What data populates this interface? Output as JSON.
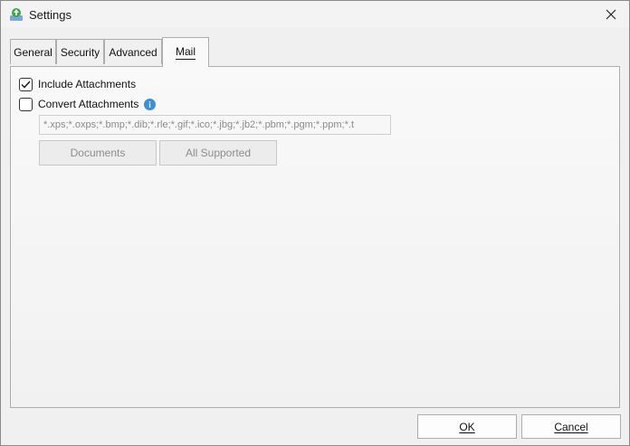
{
  "window": {
    "title": "Settings"
  },
  "tabs": [
    {
      "label": "General",
      "active": false
    },
    {
      "label": "Security",
      "active": false
    },
    {
      "label": "Advanced",
      "active": false
    },
    {
      "label": "Mail",
      "active": true
    }
  ],
  "mail": {
    "include_attachments": {
      "label": "Include Attachments",
      "checked": true
    },
    "convert_attachments": {
      "label": "Convert Attachments",
      "checked": false
    },
    "extensions_value": "*.xps;*.oxps;*.bmp;*.dib;*.rle;*.gif;*.ico;*.jbg;*.jb2;*.pbm;*.pgm;*.ppm;*.t",
    "documents_button": "Documents",
    "all_supported_button": "All Supported"
  },
  "footer": {
    "ok_label": "OK",
    "cancel_label": "Cancel"
  },
  "colors": {
    "accent": "#1e88e5",
    "info": "#3b8fd9",
    "app_icon_green": "#2e9d3a"
  }
}
